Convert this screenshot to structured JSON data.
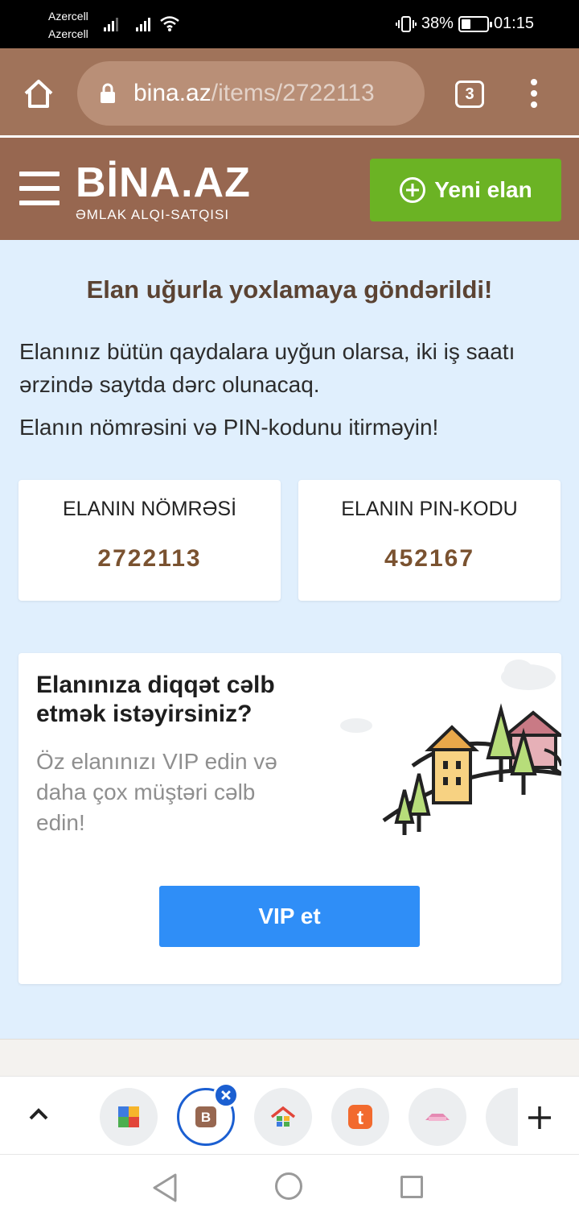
{
  "status_bar": {
    "carrier_1": "Azercell",
    "carrier_2": "Azercell",
    "battery": "38%",
    "battery_level": 0.38,
    "time": "01:15"
  },
  "browser": {
    "url_host": "bina.az",
    "url_path": "/items/2722113",
    "tab_count": "3"
  },
  "site": {
    "logo_main": "BİNA.AZ",
    "logo_sub": "ƏMLAK ALQI-SATQISI",
    "new_ad_label": "Yeni elan",
    "colors": {
      "header": "#976750",
      "browser_bar": "#a0735a",
      "green": "#6bb324",
      "blue": "#2f8ef7"
    }
  },
  "main": {
    "headline": "Elan uğurla yoxlamaya göndərildi!",
    "info_1": "Elanınız bütün qaydalara uyğun olarsa, iki iş saatı ərzində saytda dərc olunacaq.",
    "info_2": "Elanın nömrəsini və PIN-kodunu itirməyin!",
    "ad_number_label": "ELANIN NÖMRƏSİ",
    "ad_number_value": "2722113",
    "pin_label": "ELANIN PIN-KODU",
    "pin_value": "452167"
  },
  "promo": {
    "title": "Elanınıza diqqət cəlb etmək istəyirsiniz?",
    "text": "Öz elanınızı VIP edin və daha çox müştəri cəlb edin!",
    "vip_label": "VIP et"
  },
  "tab_bar": {
    "icons": [
      "chevron-up-icon",
      "tab-favicon-colorful",
      "tab-favicon-bina",
      "tab-favicon-house",
      "tab-favicon-t",
      "tab-favicon-pink",
      "plus-icon"
    ],
    "active_tab_letter": "B",
    "t_letter": "t"
  }
}
